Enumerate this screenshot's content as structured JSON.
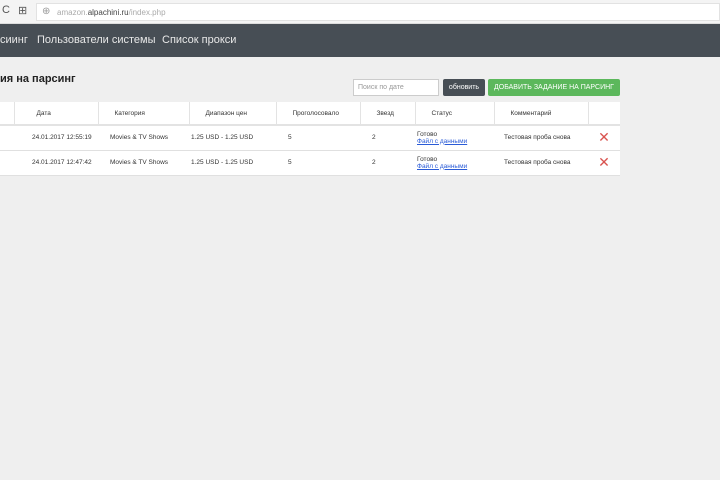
{
  "browser": {
    "url_prefix": "amazon.",
    "url_domain": "alpachini.ru",
    "url_path": "/index.php"
  },
  "nav": {
    "items": [
      "сиинг",
      "Пользователи системы",
      "Список прокси"
    ]
  },
  "page": {
    "title": "ия на парсинг",
    "search_placeholder": "Поиск по дате",
    "refresh_label": "обновить",
    "add_label": "ДОБАВИТЬ ЗАДАНИЕ НА ПАРСИНГ"
  },
  "table": {
    "headers": [
      "",
      "Дата",
      "Категория",
      "Диапазон цен",
      "Проголосовало",
      "Звезд",
      "Статус",
      "Комментарий",
      ""
    ],
    "rows": [
      {
        "date": "24.01.2017 12:55:19",
        "category": "Movies & TV Shows",
        "price": "1.25 USD - 1.25 USD",
        "votes": "5",
        "stars": "2",
        "status": "Готово",
        "link": "Файл с данными",
        "comment": "Тестовая проба снова"
      },
      {
        "date": "24.01.2017 12:47:42",
        "category": "Movies & TV Shows",
        "price": "1.25 USD - 1.25 USD",
        "votes": "5",
        "stars": "2",
        "status": "Готово",
        "link": "Файл с данными",
        "comment": "Тестовая проба снова"
      }
    ]
  }
}
